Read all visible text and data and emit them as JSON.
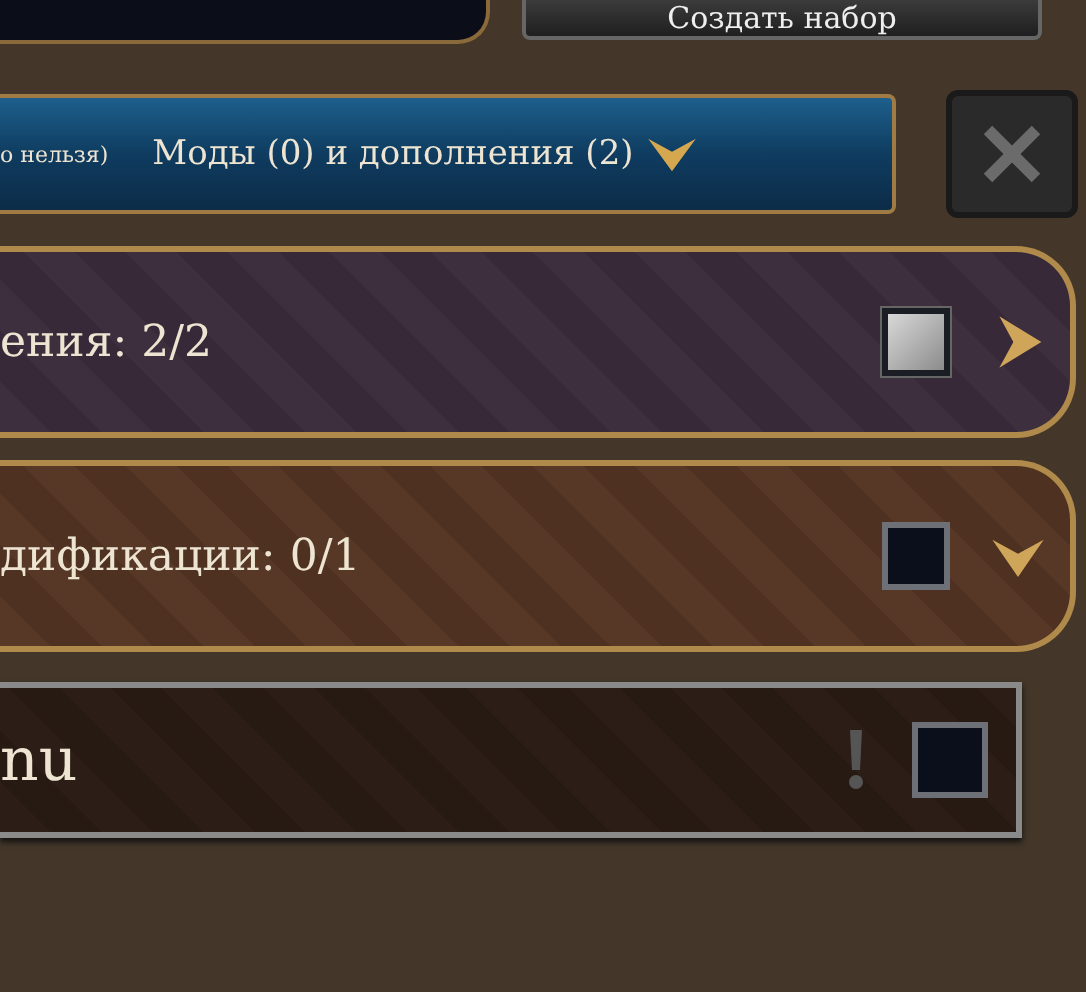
{
  "create_button": {
    "label": "Создать набор"
  },
  "mods_bar": {
    "note": "о нельзя)",
    "label": "Моды (0) и дополнения (2)",
    "expanded": true
  },
  "categories": [
    {
      "kind": "group",
      "label": "ения: 2/2",
      "checked": true,
      "expanded": false
    },
    {
      "kind": "group",
      "label": "дификации: 0/1",
      "checked": false,
      "expanded": true
    },
    {
      "kind": "item",
      "label": "nu",
      "checked": false,
      "warning": true
    }
  ]
}
